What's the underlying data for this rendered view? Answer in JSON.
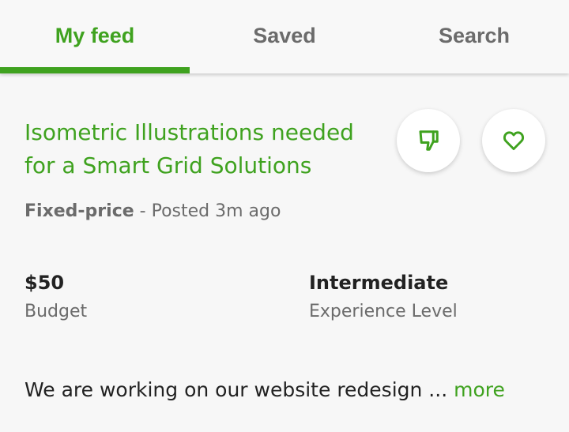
{
  "tabs": [
    {
      "label": "My feed",
      "active": true
    },
    {
      "label": "Saved",
      "active": false
    },
    {
      "label": "Search",
      "active": false
    }
  ],
  "job": {
    "title_line1": "Isometric Illustrations needed",
    "title_line2": "for a Smart Grid Solutions",
    "type": "Fixed-price",
    "posted": " - Posted 3m ago",
    "budget_value": "$50",
    "budget_label": "Budget",
    "level_value": "Intermediate",
    "level_label": "Experience Level",
    "description": "We are working on our website redesign ... ",
    "more_label": "more"
  },
  "icons": {
    "dislike": "thumbs-down-icon",
    "save": "heart-icon"
  },
  "colors": {
    "accent": "#3fa21f",
    "text": "#222222",
    "muted": "#6b6b6b",
    "background": "#f7f7f7"
  }
}
